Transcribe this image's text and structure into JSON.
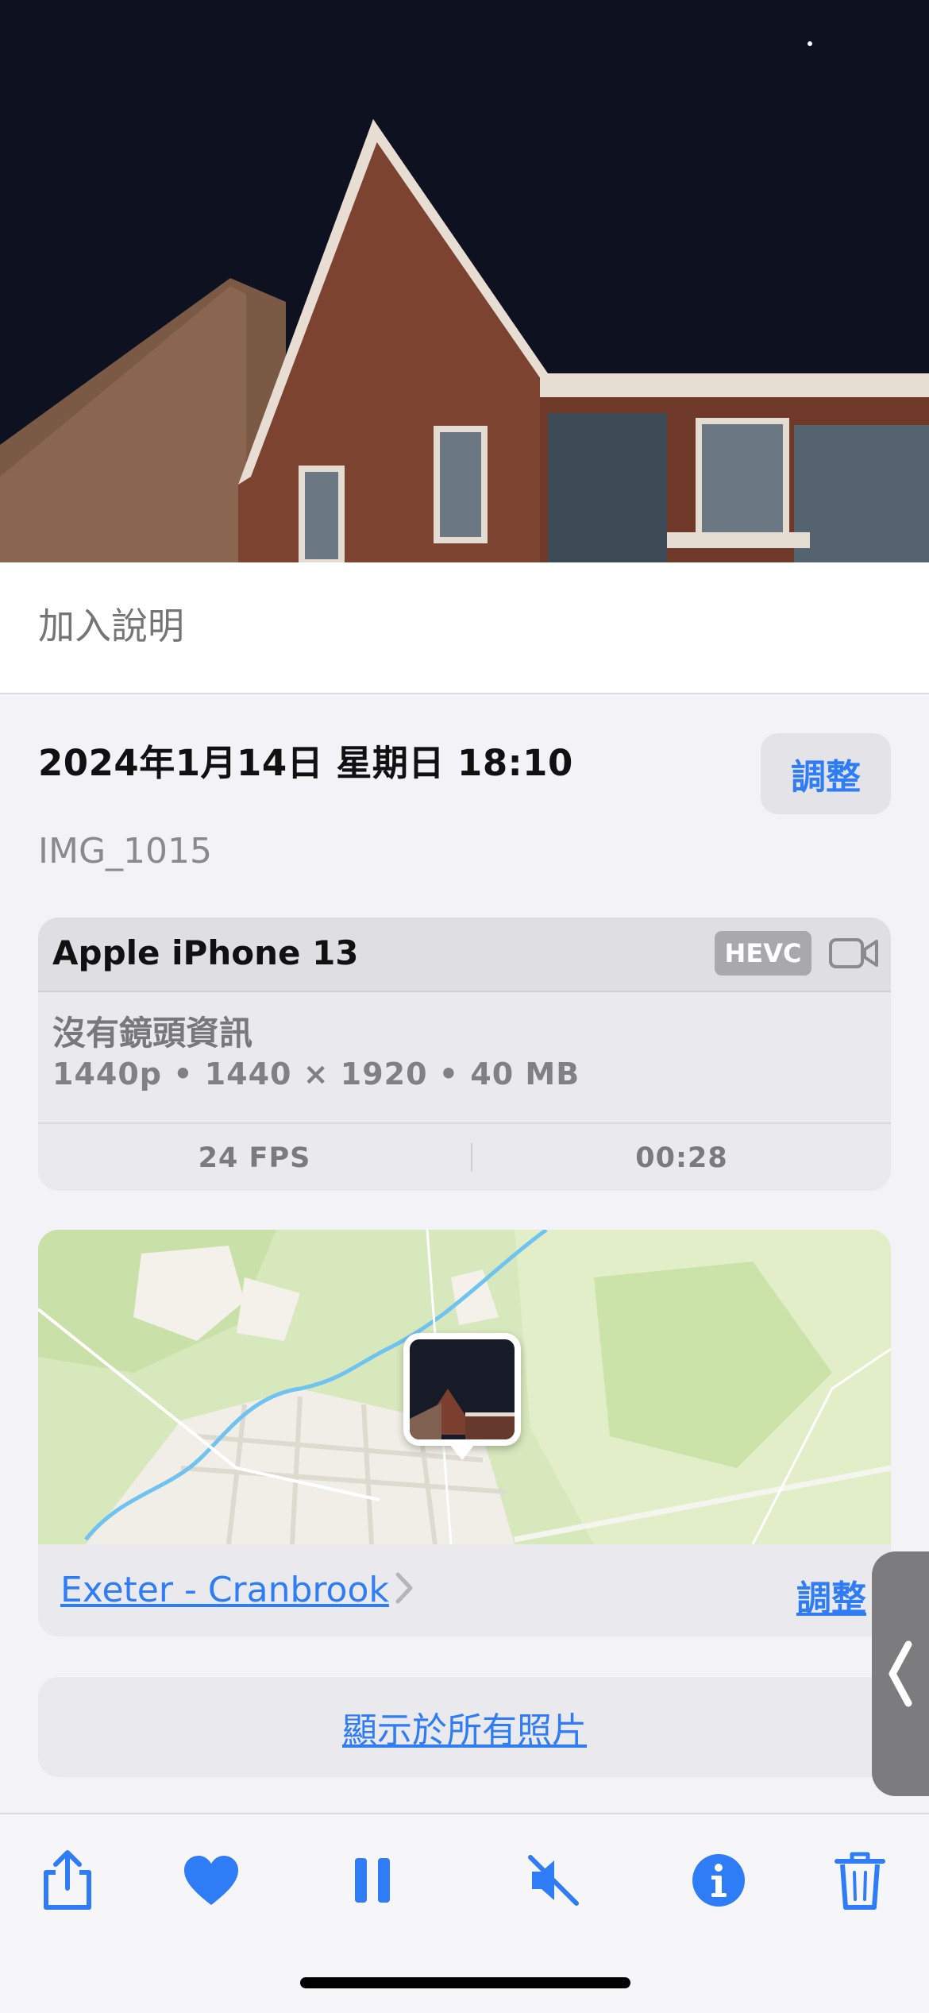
{
  "caption": {
    "placeholder": "加入說明"
  },
  "info": {
    "date": "2024年1月14日 星期日 18:10",
    "adjust_label": "調整",
    "filename": "IMG_1015"
  },
  "device": {
    "name": "Apple iPhone 13",
    "format_badge": "HEVC",
    "lens": "沒有鏡頭資訊",
    "specs": "1440p • 1440 × 1920 • 40 MB",
    "fps": "24 FPS",
    "duration": "00:28"
  },
  "location": {
    "name": "Exeter - Cranbrook",
    "adjust_label": "調整"
  },
  "show_all_label": "顯示於所有照片",
  "toolbar": {
    "items": [
      "share-icon",
      "heart-icon",
      "pause-icon",
      "mute-icon",
      "info-icon",
      "trash-icon"
    ]
  },
  "colors": {
    "accent": "#2e7cf6",
    "background": "#f2f2f7"
  }
}
